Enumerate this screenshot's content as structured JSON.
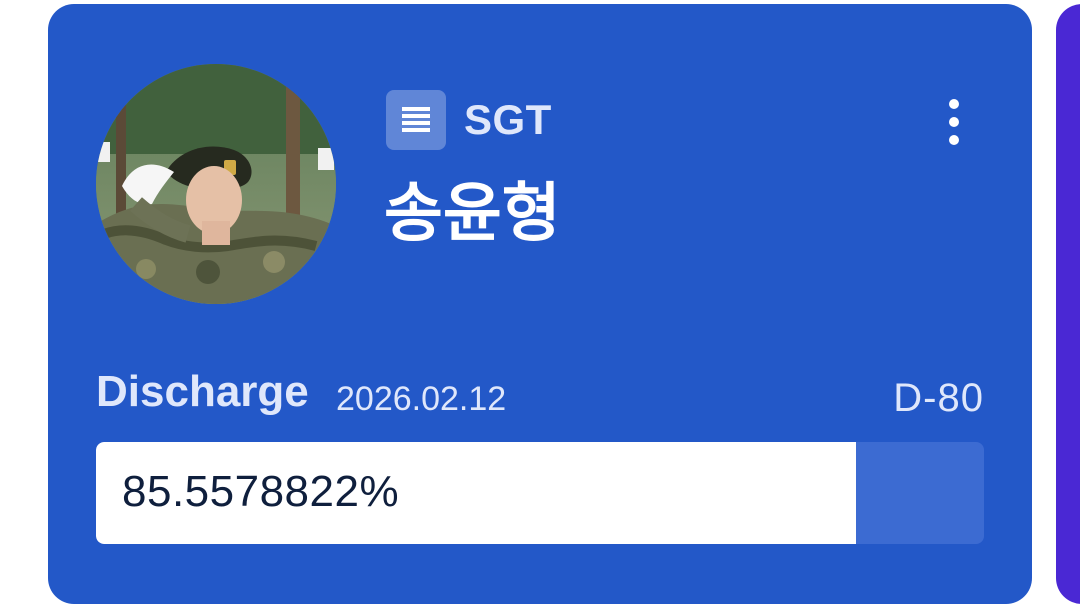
{
  "profile": {
    "rank": "SGT",
    "name": "송윤형",
    "rank_icon": "rank-stripes-icon",
    "menu_icon": "more-vertical-icon"
  },
  "discharge": {
    "label": "Discharge",
    "date": "2026.02.12",
    "d_day": "D-80",
    "progress_text": "85.5578822%",
    "progress_fraction": 0.855578822
  },
  "colors": {
    "card_background": "#2358c8",
    "next_card_background": "#4a28d4",
    "progress_fill": "#ffffff",
    "progress_track": "#3c6bd2"
  }
}
